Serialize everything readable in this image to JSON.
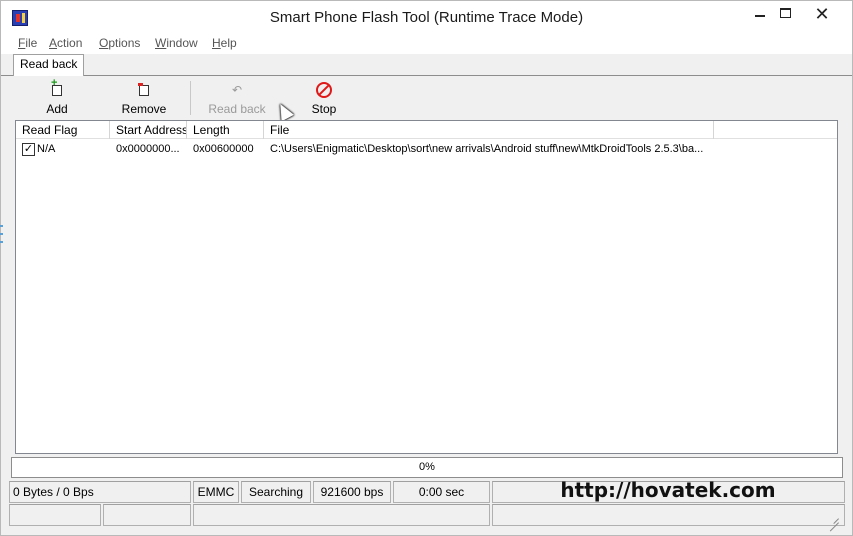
{
  "window": {
    "title": "Smart Phone Flash Tool (Runtime Trace Mode)",
    "min_glyph": "",
    "close_glyph": "✕"
  },
  "menu": [
    {
      "label_ul": "F",
      "label_rest": "ile"
    },
    {
      "label_ul": "A",
      "label_rest": "ction"
    },
    {
      "label_ul": "O",
      "label_rest": "ptions"
    },
    {
      "label_ul": "W",
      "label_rest": "indow"
    },
    {
      "label_ul": "H",
      "label_rest": "elp"
    }
  ],
  "tab": {
    "label": "Read back"
  },
  "toolbar": {
    "add": {
      "label": "Add",
      "icon": "add-file-icon"
    },
    "remove": {
      "label": "Remove",
      "icon": "remove-file-icon"
    },
    "read_back": {
      "label": "Read back",
      "icon": "undo-arrow-icon",
      "glyph": "↶",
      "enabled": false
    },
    "stop": {
      "label": "Stop",
      "icon": "stop-icon"
    }
  },
  "list": {
    "columns": [
      "Read Flag",
      "Start Address",
      "Length",
      "File"
    ],
    "rows": [
      {
        "checked": true,
        "check_glyph": "✓",
        "read_flag": "N/A",
        "start_address": "0x0000000...",
        "length": "0x00600000",
        "file": "C:\\Users\\Enigmatic\\Desktop\\sort\\new arrivals\\Android stuff\\new\\MtkDroidTools 2.5.3\\ba..."
      }
    ]
  },
  "progress": {
    "value": 0,
    "text": "0%",
    "color": "#06b025"
  },
  "status": {
    "bytes": "0 Bytes / 0 Bps",
    "storage": "EMMC",
    "state": "Searching",
    "baud": "921600 bps",
    "time": "0:00 sec",
    "watermark": "http://hovatek.com"
  }
}
